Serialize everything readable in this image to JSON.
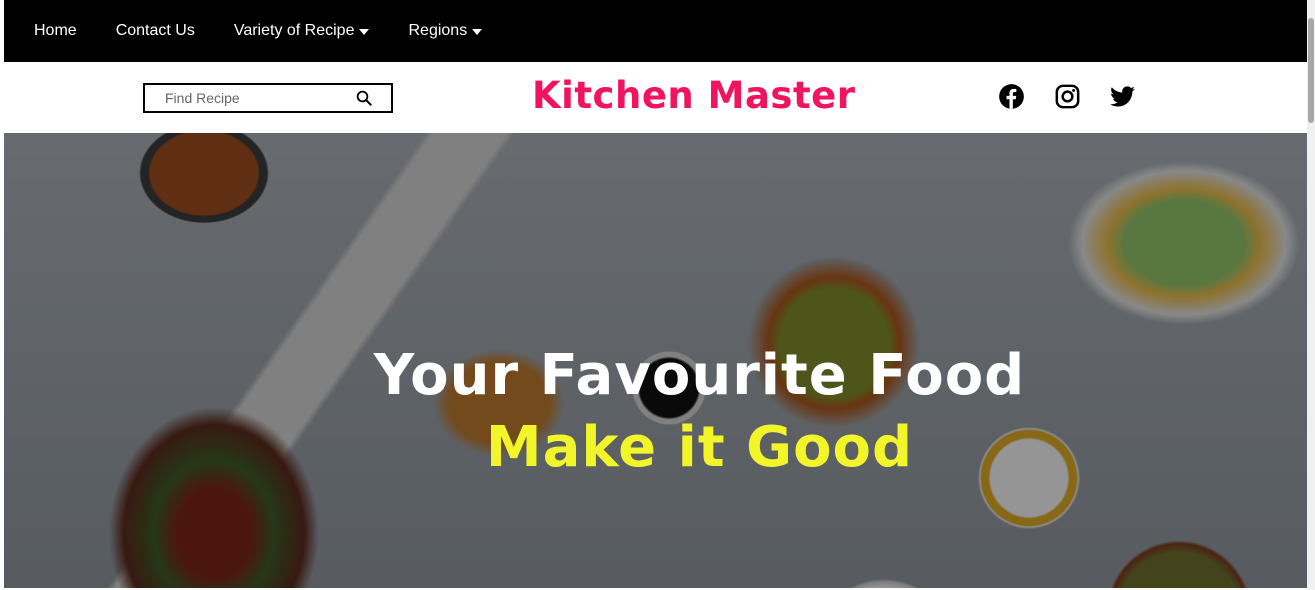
{
  "nav": {
    "items": [
      {
        "label": "Home",
        "has_dropdown": false
      },
      {
        "label": "Contact Us",
        "has_dropdown": false
      },
      {
        "label": "Variety of Recipe",
        "has_dropdown": true
      },
      {
        "label": "Regions",
        "has_dropdown": true
      }
    ]
  },
  "header": {
    "search": {
      "placeholder": "Find Recipe",
      "value": "",
      "icon": "search-icon"
    },
    "brand": "Kitchen Master",
    "brand_color": "#f0135e",
    "social": [
      {
        "name": "facebook",
        "icon": "facebook-icon"
      },
      {
        "name": "instagram",
        "icon": "instagram-icon"
      },
      {
        "name": "twitter",
        "icon": "twitter-icon"
      }
    ]
  },
  "hero": {
    "line1": "Your Favourite Food",
    "line2": "Make it Good",
    "line1_color": "#ffffff",
    "line2_color": "#f3f52b"
  }
}
